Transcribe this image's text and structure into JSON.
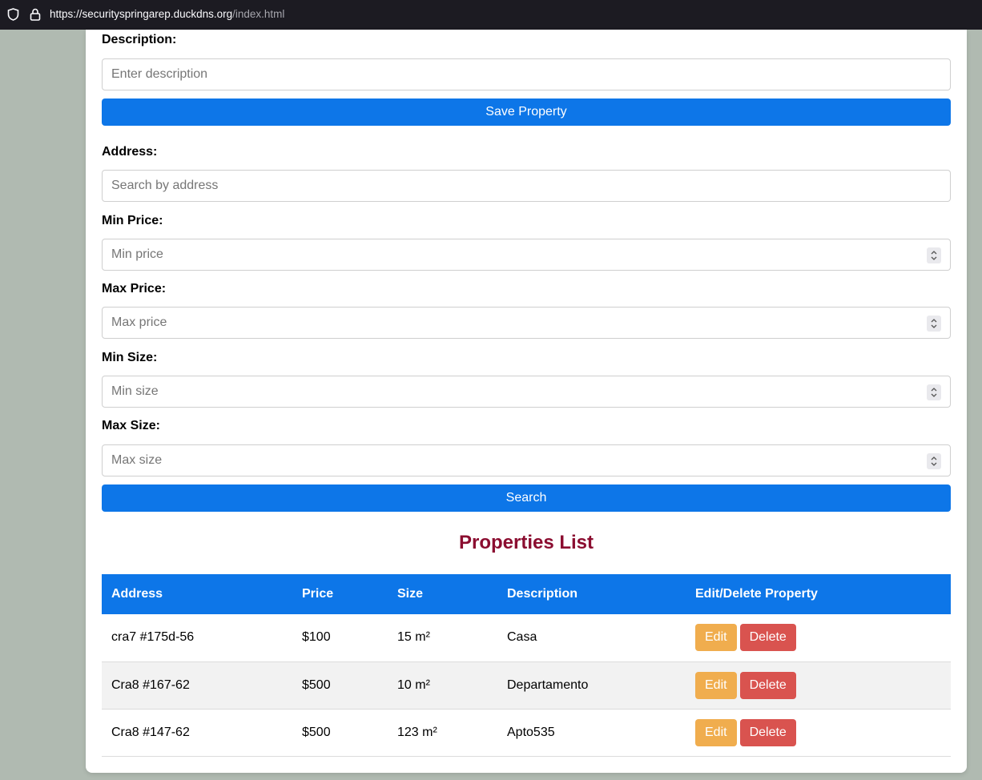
{
  "browser": {
    "url_host": "https://securityspringarep.duckdns.org",
    "url_path": "/index.html"
  },
  "form": {
    "description_label": "Description:",
    "description_placeholder": "Enter description",
    "save_label": "Save Property"
  },
  "search": {
    "address_label": "Address:",
    "address_placeholder": "Search by address",
    "min_price_label": "Min Price:",
    "min_price_placeholder": "Min price",
    "max_price_label": "Max Price:",
    "max_price_placeholder": "Max price",
    "min_size_label": "Min Size:",
    "min_size_placeholder": "Min size",
    "max_size_label": "Max Size:",
    "max_size_placeholder": "Max size",
    "search_label": "Search"
  },
  "list": {
    "title": "Properties List",
    "headers": [
      "Address",
      "Price",
      "Size",
      "Description",
      "Edit/Delete Property"
    ],
    "edit_label": "Edit",
    "delete_label": "Delete",
    "rows": [
      {
        "address": "cra7 #175d-56",
        "price": "$100",
        "size": "15 m²",
        "description": "Casa"
      },
      {
        "address": "Cra8 #167-62",
        "price": "$500",
        "size": "10 m²",
        "description": "Departamento"
      },
      {
        "address": "Cra8 #147-62",
        "price": "$500",
        "size": "123 m²",
        "description": "Apto535"
      }
    ]
  },
  "colors": {
    "primary": "#0d76e8",
    "title": "#8b0d30",
    "edit": "#f0ad4e",
    "delete": "#d9534f",
    "page_bg": "#b0bab1"
  }
}
